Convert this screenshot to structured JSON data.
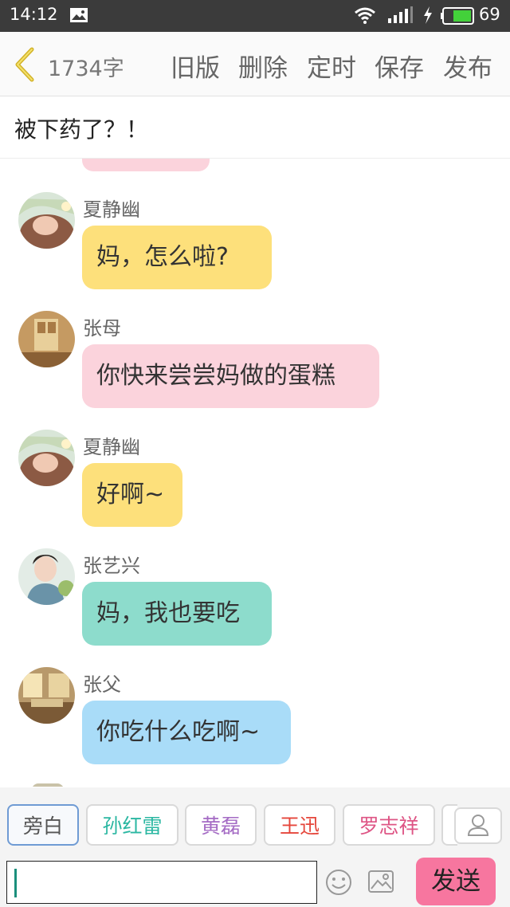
{
  "status_bar": {
    "time": "14:12",
    "battery_percent": "69",
    "battery_level": 0.69,
    "icons": [
      "image-icon",
      "wifi-icon",
      "signal-icon",
      "charging-icon",
      "battery-icon"
    ]
  },
  "toolbar": {
    "word_count": "1734字",
    "buttons": [
      "旧版",
      "删除",
      "定时",
      "保存",
      "发布"
    ]
  },
  "story": {
    "title": "被下药了？！"
  },
  "messages": [
    {
      "sender": "夏静幽",
      "text": "妈，怎么啦?",
      "color": "#fde07b"
    },
    {
      "sender": "张母",
      "text": "你快来尝尝妈做的蛋糕",
      "color": "#fbd3dc"
    },
    {
      "sender": "夏静幽",
      "text": "好啊~",
      "color": "#fde07b"
    },
    {
      "sender": "张艺兴",
      "text": "妈，我也要吃",
      "color": "#8ddccc"
    },
    {
      "sender": "张父",
      "text": "你吃什么吃啊~",
      "color": "#a9dcf8"
    }
  ],
  "roles": [
    {
      "label": "旁白",
      "color": "#555555"
    },
    {
      "label": "孙红雷",
      "color": "#2bb7a2"
    },
    {
      "label": "黄磊",
      "color": "#a46bc4"
    },
    {
      "label": "王迅",
      "color": "#e5463b"
    },
    {
      "label": "罗志祥",
      "color": "#de5585"
    }
  ],
  "composer": {
    "send_label": "发送"
  }
}
